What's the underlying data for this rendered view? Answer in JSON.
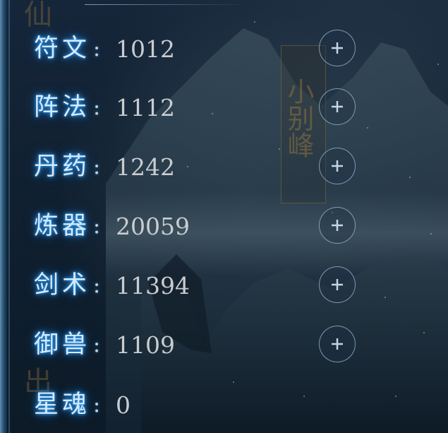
{
  "stats": [
    {
      "label": "符文",
      "sep": ":",
      "value": "1012",
      "has_add": true,
      "add_icon": "plus-icon"
    },
    {
      "label": "阵法",
      "sep": ":",
      "value": "1112",
      "has_add": true,
      "add_icon": "plus-icon"
    },
    {
      "label": "丹药",
      "sep": ":",
      "value": "1242",
      "has_add": true,
      "add_icon": "plus-icon"
    },
    {
      "label": "炼器",
      "sep": ":",
      "value": "20059",
      "has_add": true,
      "add_icon": "plus-icon"
    },
    {
      "label": "剑术",
      "sep": ":",
      "value": "11394",
      "has_add": true,
      "add_icon": "plus-icon"
    },
    {
      "label": "御兽",
      "sep": ":",
      "value": "1109",
      "has_add": true,
      "add_icon": "plus-icon"
    },
    {
      "label": "星魂",
      "sep": ":",
      "value": "0",
      "has_add": false
    }
  ],
  "background": {
    "signboard_text": "小别峰",
    "faded_top": "仙",
    "faded_bottom": "出"
  },
  "colors": {
    "label_glow": "#2ea3ff",
    "value_text": "#c9ccd0",
    "button_ring": "#96b4cd"
  }
}
